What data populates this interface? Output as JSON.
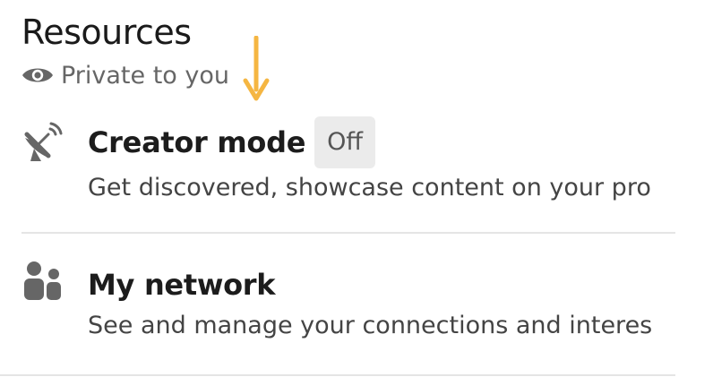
{
  "section": {
    "title": "Resources",
    "privacy_label": "Private to you",
    "privacy_icon": "eye-icon"
  },
  "annotation": {
    "arrow_icon": "arrow-down-icon",
    "arrow_color": "#f5b642"
  },
  "items": [
    {
      "icon": "satellite-dish-icon",
      "title": "Creator mode",
      "status": "Off",
      "description": "Get discovered, showcase content on your pro"
    },
    {
      "icon": "people-icon",
      "title": "My network",
      "description": "See and manage your connections and interes"
    }
  ],
  "colors": {
    "icon": "#666666",
    "status_pill_bg": "#ebebeb",
    "divider": "#e5e5e5"
  }
}
